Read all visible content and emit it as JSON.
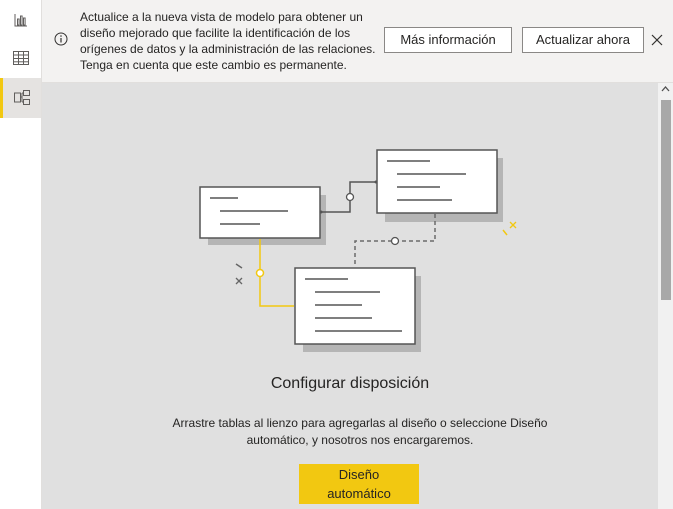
{
  "rail": {
    "items": [
      {
        "name": "report-view",
        "icon": "bar-chart-icon"
      },
      {
        "name": "data-view",
        "icon": "table-icon"
      },
      {
        "name": "model-view",
        "icon": "model-icon",
        "active": true
      }
    ]
  },
  "banner": {
    "text": "Actualice a la nueva vista de modelo para obtener un diseño mejorado que facilite la identificación de los orígenes de datos y la administración de las relaciones. Tenga en cuenta que este cambio es permanente.",
    "more_info_label": "Más información",
    "update_now_label": "Actualizar ahora",
    "icon": "info-icon",
    "close_icon": "close-icon"
  },
  "main": {
    "title": "Configurar disposición",
    "description": "Arrastre tablas al lienzo para agregarlas al diseño o seleccione Diseño automático, y nosotros nos encargaremos.",
    "auto_layout_label": "Diseño automático"
  },
  "colors": {
    "accent": "#f2c811",
    "canvas": "#e0e0e0",
    "banner": "#f3f2f1"
  }
}
